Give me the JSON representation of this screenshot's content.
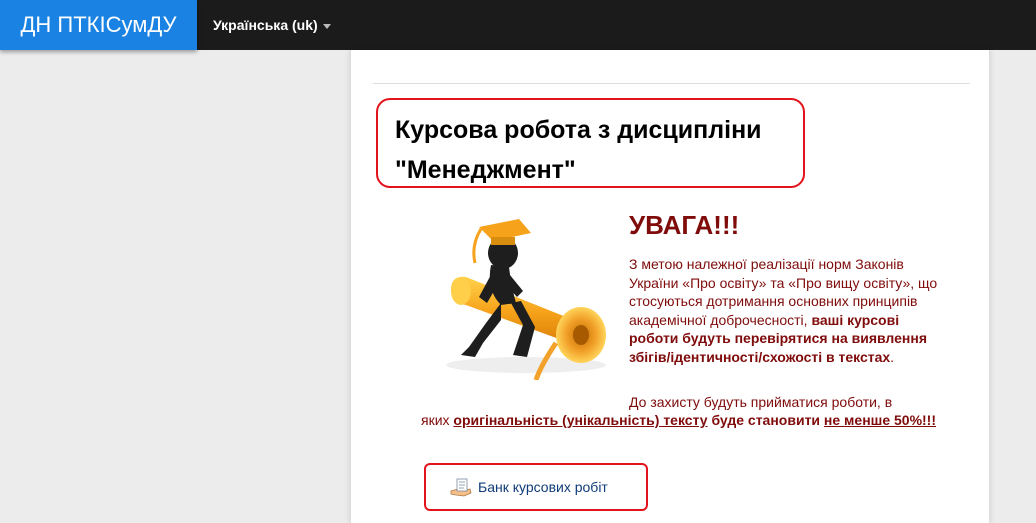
{
  "navbar": {
    "brand": "ДН ПТКІСумДУ",
    "language": "Українська (uk)"
  },
  "page": {
    "title": "Курсова робота з дисципліни \"Менеджмент\"",
    "warning_title": "УВАГА!!!",
    "para1_normal1": "З метою належної реалізації норм Законів України «Про освіту» та «Про вищу освіту», що стосуються дотримання основних принципів академічної доброчесності, ",
    "para1_bold": "ваші курсові роботи будуть перевірятися на виявлення збігів/ідентичності/схожості в текстах",
    "para1_end": ".",
    "para2_lead": "До захисту будуть прийматися роботи, в",
    "para2_part1": "яких ",
    "para2_link1": "оригінальність (унікальність) тексту",
    "para2_part2": " буде становити ",
    "para2_link2": "не менше 50%!!! ",
    "bank_link": "Банк курсових робіт"
  },
  "icons": {
    "illustration": "graduate-scroll-illustration",
    "bank": "hand-document-icon"
  },
  "colors": {
    "brand_bg": "#1a82e2",
    "navbar_bg": "#1b1b1b",
    "warning_text": "#7f0b0b",
    "highlight_border": "#e3131b"
  }
}
